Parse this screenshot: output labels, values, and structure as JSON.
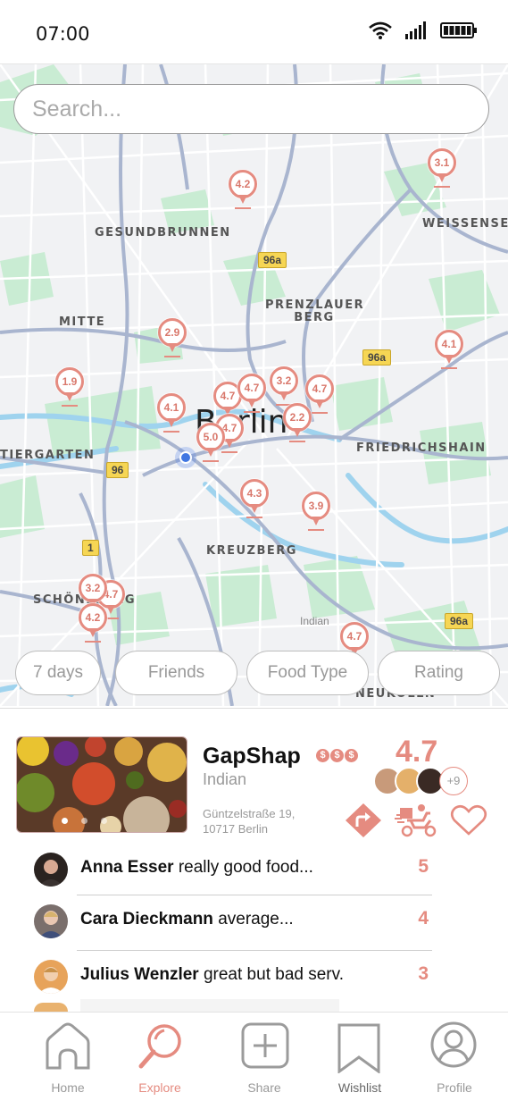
{
  "status_bar": {
    "time": "07:00"
  },
  "search": {
    "placeholder": "Search..."
  },
  "map": {
    "districts": [
      "GESUNDBRUNNEN",
      "WEISSENSEE",
      "PRENZLAUER BERG",
      "MITTE",
      "FRIEDRICHSHAIN",
      "TIERGARTEN",
      "KREUZBERG",
      "SCHÖNEBERG",
      "NEUKÖLLN"
    ],
    "city_label": "Berlin",
    "road_labels": [
      "96a",
      "96a",
      "96a",
      "96",
      "1"
    ],
    "minor_label": "Indian",
    "pins": [
      "4.2",
      "3.1",
      "2.9",
      "4.1",
      "1.9",
      "4.1",
      "4.7",
      "4.7",
      "3.2",
      "4.7",
      "2.2",
      "4.7",
      "5.0",
      "4.3",
      "3.9",
      "3.2",
      "4.7",
      "4.2",
      "4.7"
    ]
  },
  "filters": [
    "7 days",
    "Friends",
    "Food Type",
    "Rating"
  ],
  "restaurant": {
    "name": "GapShap",
    "price_symbol": "$",
    "cuisine": "Indian",
    "address_line1": "Güntzelstraße 19,",
    "address_line2": "10717 Berlin",
    "rating": "4.7",
    "more_friends": "+9",
    "accent_color": "#e58b80"
  },
  "reviews": [
    {
      "name": "Anna Esser",
      "text": "really good food...",
      "score": "5"
    },
    {
      "name": "Cara Dieckmann",
      "text": "average...",
      "score": "4"
    },
    {
      "name": "Julius Wenzler",
      "text": "great but bad serv.",
      "score": "3"
    }
  ],
  "tabs": [
    {
      "label": "Home",
      "icon": "home-icon"
    },
    {
      "label": "Explore",
      "icon": "magnifier-icon",
      "active": true
    },
    {
      "label": "Share",
      "icon": "plus-square-icon"
    },
    {
      "label": "Wishlist",
      "icon": "bookmark-icon"
    },
    {
      "label": "Profile",
      "icon": "user-icon"
    }
  ]
}
